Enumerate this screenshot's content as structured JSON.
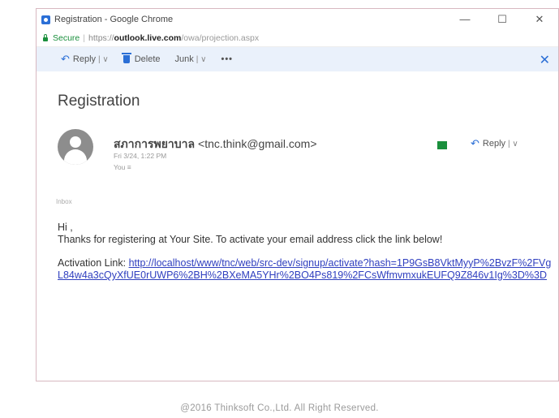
{
  "window": {
    "title": "Registration - Google Chrome",
    "controls": {
      "minimize": "—",
      "maximize": "☐",
      "close": "✕"
    }
  },
  "address_bar": {
    "secure_label": "Secure",
    "url_protocol": "https://",
    "url_domain": "outlook.live.com",
    "url_path": "/owa/projection.aspx"
  },
  "toolbar": {
    "reply_label": "Reply",
    "delete_label": "Delete",
    "junk_label": "Junk",
    "more_label": "•••",
    "close_label": "✕"
  },
  "message": {
    "subject": "Registration",
    "sender_name": "สภาการพยาบาล",
    "sender_email": "<tnc.think@gmail.com>",
    "date": "Fri 3/24, 1:22 PM",
    "to": "You ≡",
    "reply_label": "Reply",
    "folder": "Inbox",
    "greeting": "Hi ,",
    "body": "Thanks for registering at Your Site. To activate your email address click the link below!",
    "activation_label": "Activation Link:",
    "activation_link": "http://localhost/www/tnc/web/src-dev/signup/activate?hash=1P9GsB8VktMyyP%2BvzF%2FVgL84w4a3cQyXfUE0rUWP6%2BH%2BXeMA5YHr%2BO4Ps819%2FCsWfmvmxukEUFQ9Z846v1Ig%3D%3D"
  },
  "footer": {
    "text": "@2016 Thinksoft Co.,Ltd. All Right Reserved."
  }
}
